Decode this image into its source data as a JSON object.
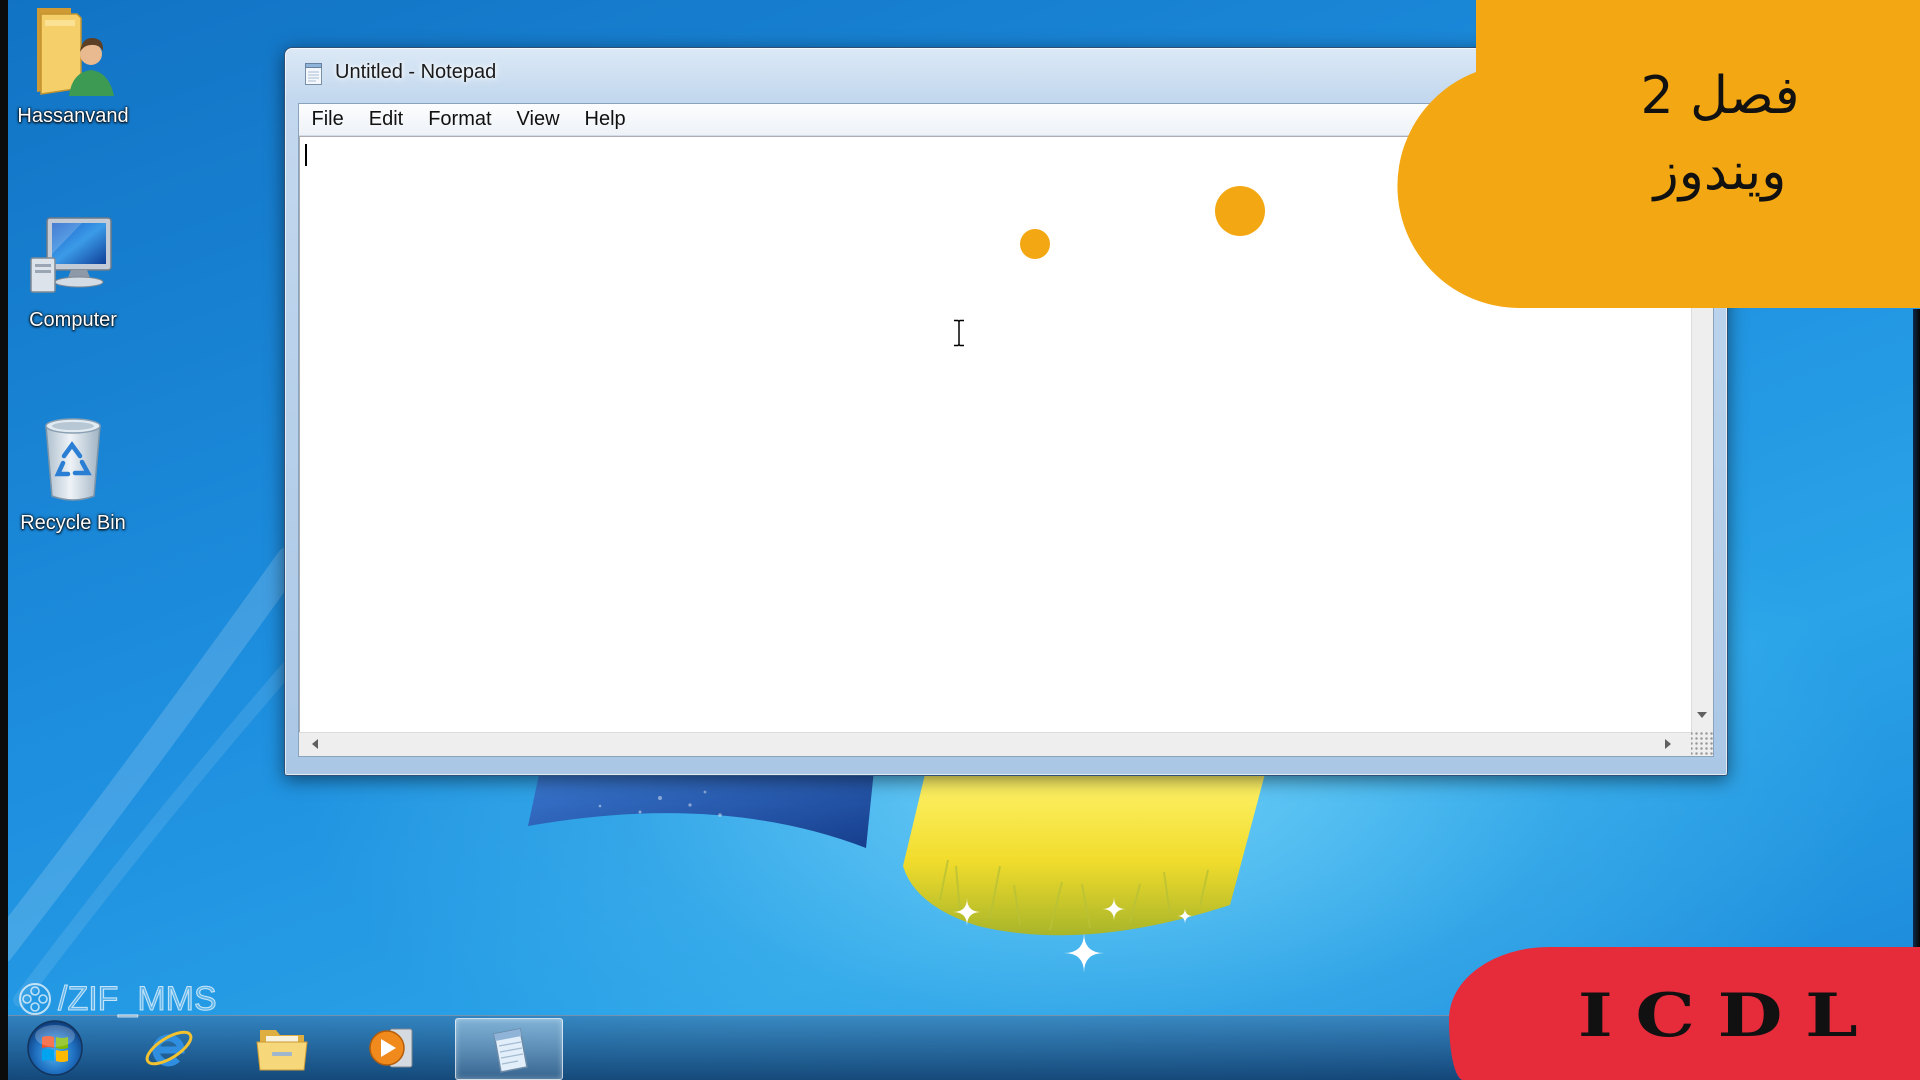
{
  "desktop": {
    "icons": [
      {
        "label": "Hassanvand",
        "icon": "user-folder-icon"
      },
      {
        "label": "Computer",
        "icon": "computer-icon"
      },
      {
        "label": "Recycle Bin",
        "icon": "recycle-bin-icon"
      }
    ]
  },
  "notepad": {
    "title": "Untitled - Notepad",
    "icon": "notepad-icon",
    "menu": [
      "File",
      "Edit",
      "Format",
      "View",
      "Help"
    ]
  },
  "overlay": {
    "chapter": "فصل 2",
    "subject": "ويندوز",
    "badge": "ICDL"
  },
  "watermark": {
    "text": "/ZIF_MMS",
    "icon": "film-reel-icon"
  },
  "taskbar": {
    "start_icon": "windows-start-orb-icon",
    "pinned": [
      {
        "icon": "internet-explorer-icon",
        "active": false
      },
      {
        "icon": "windows-explorer-icon",
        "active": false
      },
      {
        "icon": "media-player-icon",
        "active": false
      },
      {
        "icon": "notepad-icon",
        "active": true
      }
    ]
  },
  "cursor": {
    "icon": "text-ibeam-cursor-icon"
  },
  "colors": {
    "overlay_orange": "#F3A712",
    "badge_red": "#E62B3B",
    "desktop_blue": "#1E8FDF",
    "badge_text": "#111111"
  }
}
